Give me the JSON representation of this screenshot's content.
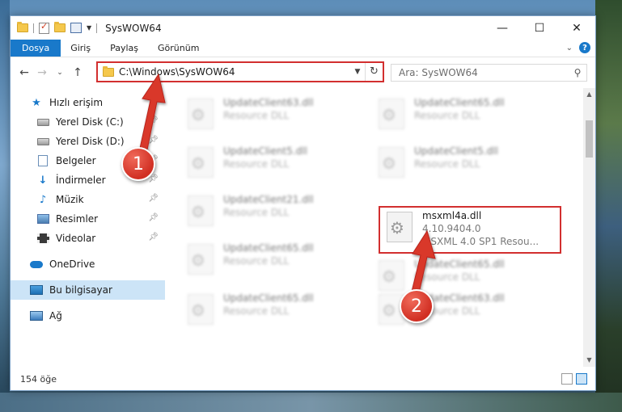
{
  "window": {
    "title": "SysWOW64",
    "controls": {
      "minimize": "—",
      "maximize": "☐",
      "close": "✕"
    }
  },
  "ribbon": {
    "tabs": [
      "Dosya",
      "Giriş",
      "Paylaş",
      "Görünüm"
    ],
    "help": "?"
  },
  "address": {
    "path": "C:\\Windows\\SysWOW64",
    "search_placeholder": "Ara: SysWOW64"
  },
  "sidebar": {
    "quick_access": "Hızlı erişim",
    "items": [
      {
        "label": "Yerel Disk (C:)",
        "icon": "disk-icon"
      },
      {
        "label": "Yerel Disk (D:)",
        "icon": "disk-icon"
      },
      {
        "label": "Belgeler",
        "icon": "documents-icon"
      },
      {
        "label": "İndirmeler",
        "icon": "download-icon"
      },
      {
        "label": "Müzik",
        "icon": "music-icon"
      },
      {
        "label": "Resimler",
        "icon": "pictures-icon"
      },
      {
        "label": "Videolar",
        "icon": "videos-icon"
      }
    ],
    "onedrive": "OneDrive",
    "this_pc": "Bu bilgisayar",
    "network": "Ağ"
  },
  "files": [
    {
      "name": "UpdateClient63.dll",
      "desc": "Resource DLL",
      "blurred": true
    },
    {
      "name": "UpdateClient65.dll",
      "desc": "Resource DLL",
      "blurred": true
    },
    {
      "name": "UpdateClient5.dll",
      "desc": "Resource DLL",
      "blurred": true
    },
    {
      "name": "UpdateClient5.dll",
      "desc": "Resource DLL",
      "blurred": true
    },
    {
      "name": "UpdateClient21.dll",
      "desc": "Resource DLL",
      "blurred": true
    },
    {
      "name": "msxml4a.dll",
      "version": "4.10.9404.0",
      "desc": "MSXML 4.0 SP1 Resou...",
      "blurred": false
    },
    {
      "name": "UpdateClient65.dll",
      "desc": "Resource DLL",
      "blurred": true
    },
    {
      "name": "UpdateClient65.dll",
      "desc": "Resource DLL",
      "blurred": true
    },
    {
      "name": "UpdateClient65.dll",
      "desc": "Resource DLL",
      "blurred": true
    },
    {
      "name": "UpdateClient63.dll",
      "desc": "Resource DLL",
      "blurred": true
    }
  ],
  "status": {
    "item_count": "154 öğe"
  },
  "callouts": {
    "one": "1",
    "two": "2"
  },
  "colors": {
    "accent": "#1979ca",
    "annotation": "#d22f2f",
    "selected": "#cce4f7"
  }
}
